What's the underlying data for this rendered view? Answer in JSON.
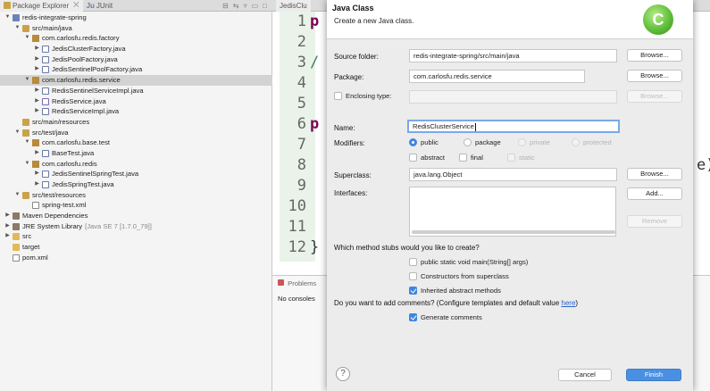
{
  "explorer": {
    "tabs": [
      {
        "label": "Package Explorer",
        "icon": "package-explorer-icon"
      },
      {
        "label": "JUnit",
        "icon": "junit-icon"
      }
    ],
    "tree": [
      {
        "indent": 0,
        "twisty": "open",
        "icon": "project",
        "label": "redis-integrate-spring"
      },
      {
        "indent": 1,
        "twisty": "open",
        "icon": "srcfolder",
        "label": "src/main/java"
      },
      {
        "indent": 2,
        "twisty": "open",
        "icon": "package",
        "label": "com.carlosfu.redis.factory"
      },
      {
        "indent": 3,
        "twisty": "closed",
        "icon": "java",
        "label": "JedisClusterFactory.java"
      },
      {
        "indent": 3,
        "twisty": "closed",
        "icon": "java",
        "label": "JedisPoolFactory.java"
      },
      {
        "indent": 3,
        "twisty": "closed",
        "icon": "java",
        "label": "JedisSentinelPoolFactory.java"
      },
      {
        "indent": 2,
        "twisty": "open",
        "icon": "package",
        "label": "com.carlosfu.redis.service",
        "selected": true
      },
      {
        "indent": 3,
        "twisty": "closed",
        "icon": "java",
        "label": "RedisSentinelServiceImpl.java"
      },
      {
        "indent": 3,
        "twisty": "closed",
        "icon": "interface",
        "label": "RedisService.java"
      },
      {
        "indent": 3,
        "twisty": "closed",
        "icon": "java",
        "label": "RedisServiceImpl.java"
      },
      {
        "indent": 1,
        "twisty": "",
        "icon": "srcfolder",
        "label": "src/main/resources"
      },
      {
        "indent": 1,
        "twisty": "open",
        "icon": "srcfolder",
        "label": "src/test/java"
      },
      {
        "indent": 2,
        "twisty": "open",
        "icon": "package",
        "label": "com.carlosfu.base.test"
      },
      {
        "indent": 3,
        "twisty": "closed",
        "icon": "java",
        "label": "BaseTest.java"
      },
      {
        "indent": 2,
        "twisty": "open",
        "icon": "package",
        "label": "com.carlosfu.redis"
      },
      {
        "indent": 3,
        "twisty": "closed",
        "icon": "java",
        "label": "JedisSentinelSpringTest.java"
      },
      {
        "indent": 3,
        "twisty": "closed",
        "icon": "java",
        "label": "JedisSpringTest.java"
      },
      {
        "indent": 1,
        "twisty": "open",
        "icon": "srcfolder",
        "label": "src/test/resources"
      },
      {
        "indent": 2,
        "twisty": "",
        "icon": "xml",
        "label": "spring-test.xml"
      },
      {
        "indent": 0,
        "twisty": "closed",
        "icon": "library",
        "label": "Maven Dependencies"
      },
      {
        "indent": 0,
        "twisty": "closed",
        "icon": "library",
        "label": "JRE System Library",
        "decoration": "[Java SE 7 [1.7.0_79]]"
      },
      {
        "indent": 0,
        "twisty": "closed",
        "icon": "folder",
        "label": "src"
      },
      {
        "indent": 0,
        "twisty": "",
        "icon": "folder",
        "label": "target"
      },
      {
        "indent": 0,
        "twisty": "",
        "icon": "xml",
        "label": "pom.xml"
      }
    ]
  },
  "editor": {
    "tab_label": "JedisClu",
    "line_numbers": [
      "1",
      "2",
      "3",
      "4",
      "5",
      "6",
      "7",
      "8",
      "9",
      "10",
      "11",
      "12"
    ],
    "code_fragments": [
      {
        "line": 1,
        "text": "p",
        "kind": "kw"
      },
      {
        "line": 3,
        "text": "/",
        "kind": "cm"
      },
      {
        "line": 6,
        "text": "p",
        "kind": "kw"
      },
      {
        "line": 12,
        "text": "}",
        "kind": "plain"
      }
    ],
    "right_fragment": "e)",
    "bottom": {
      "tab_label": "Problems",
      "message": "No consoles"
    }
  },
  "dialog": {
    "title": "Java Class",
    "subtitle": "Create a new Java class.",
    "logo_letter": "C",
    "source_folder": {
      "label": "Source folder:",
      "value": "redis-integrate-spring/src/main/java",
      "browse": "Browse..."
    },
    "package": {
      "label": "Package:",
      "value": "com.carlosfu.redis.service",
      "browse": "Browse..."
    },
    "enclosing": {
      "label": "Enclosing type:",
      "value": "",
      "browse": "Browse..."
    },
    "name": {
      "label": "Name:",
      "value": "RedisClusterService"
    },
    "modifiers": {
      "label": "Modifiers:",
      "visibility": [
        {
          "label": "public",
          "selected": true
        },
        {
          "label": "package",
          "selected": false
        },
        {
          "label": "private",
          "selected": false,
          "disabled": true
        },
        {
          "label": "protected",
          "selected": false,
          "disabled": true
        }
      ],
      "flags": [
        {
          "label": "abstract",
          "checked": false
        },
        {
          "label": "final",
          "checked": false
        },
        {
          "label": "static",
          "checked": false,
          "disabled": true
        }
      ]
    },
    "superclass": {
      "label": "Superclass:",
      "value": "java.lang.Object",
      "browse": "Browse..."
    },
    "interfaces": {
      "label": "Interfaces:",
      "add": "Add...",
      "remove": "Remove"
    },
    "stubs": {
      "question": "Which method stubs would you like to create?",
      "options": [
        {
          "label": "public static void main(String[] args)",
          "checked": false
        },
        {
          "label": "Constructors from superclass",
          "checked": false
        },
        {
          "label": "Inherited abstract methods",
          "checked": true
        }
      ]
    },
    "comments": {
      "question": "Do you want to add comments? (Configure templates and default value ",
      "link": "here",
      "question_end": ")",
      "option": {
        "label": "Generate comments",
        "checked": true
      }
    },
    "help": "?",
    "cancel": "Cancel",
    "finish": "Finish"
  }
}
